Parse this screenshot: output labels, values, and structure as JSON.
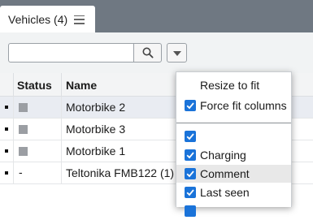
{
  "tab": {
    "title": "Vehicles (4)",
    "menu_icon": "hamburger-icon"
  },
  "toolbar": {
    "search_value": "",
    "search_placeholder": "",
    "search_icon": "search-icon",
    "dropdown_icon": "chevron-down-icon"
  },
  "grid": {
    "columns": [
      "Status",
      "Name"
    ],
    "rows": [
      {
        "status": "square",
        "name": "Motorbike 2",
        "selected": true
      },
      {
        "status": "square",
        "name": "Motorbike 3",
        "selected": false
      },
      {
        "status": "square",
        "name": "Motorbike 1",
        "selected": false
      },
      {
        "status": "-",
        "name": "Teltonika FMB122 (1)",
        "selected": false
      }
    ],
    "status_color": "#9b9ea3"
  },
  "column_menu": {
    "items": [
      {
        "label": "Resize to fit",
        "checkbox": false
      },
      {
        "label": "Force fit columns",
        "checkbox": true,
        "checked": true
      },
      {
        "label": "",
        "checkbox": true,
        "checked": true
      },
      {
        "label": "Charging",
        "checkbox": true,
        "checked": true
      },
      {
        "label": "Comment",
        "checkbox": true,
        "checked": true,
        "hover": true
      },
      {
        "label": "Last seen",
        "checkbox": true,
        "checked": true
      }
    ],
    "accent": "#1a73d9"
  }
}
